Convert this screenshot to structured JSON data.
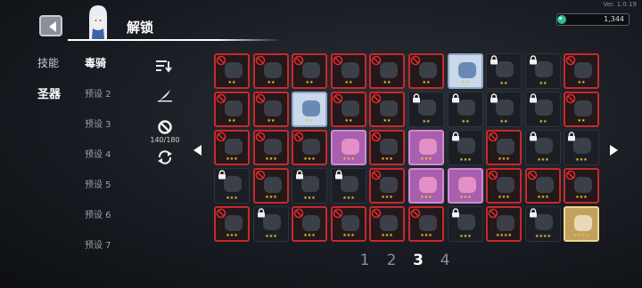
{
  "version": "Ver. 1.0.19",
  "header": {
    "title": "解锁",
    "back_icon": "back-arrow-icon"
  },
  "currency": {
    "amount": "1,344",
    "icon": "gem-icon"
  },
  "side_tabs": [
    {
      "label": "技能",
      "active": false
    },
    {
      "label": "圣器",
      "active": true
    }
  ],
  "presets": [
    {
      "label": "毒骑",
      "active": true
    },
    {
      "label": "预设 2",
      "active": false
    },
    {
      "label": "预设 3",
      "active": false
    },
    {
      "label": "预设 4",
      "active": false
    },
    {
      "label": "预设 5",
      "active": false
    },
    {
      "label": "预设 6",
      "active": false
    },
    {
      "label": "预设 7",
      "active": false
    }
  ],
  "tools": {
    "sort_icon": "sort-icon",
    "quill_icon": "quill-icon",
    "ban_icon": "ban-icon",
    "refresh_icon": "refresh-icon",
    "ban_count": "140/180"
  },
  "pagination": {
    "pages": [
      "1",
      "2",
      "3",
      "4"
    ],
    "current": "3"
  },
  "relics": [
    [
      {
        "ban": true,
        "lock": false,
        "stars": 2,
        "style": "red"
      },
      {
        "ban": true,
        "lock": false,
        "stars": 2,
        "style": "red"
      },
      {
        "ban": true,
        "lock": false,
        "stars": 2,
        "style": "red"
      },
      {
        "ban": true,
        "lock": false,
        "stars": 2,
        "style": "red"
      },
      {
        "ban": true,
        "lock": false,
        "stars": 2,
        "style": "red"
      },
      {
        "ban": true,
        "lock": false,
        "stars": 2,
        "style": "red"
      },
      {
        "ban": false,
        "lock": false,
        "stars": 2,
        "style": "blue"
      },
      {
        "ban": false,
        "lock": true,
        "stars": 2,
        "style": "dark"
      },
      {
        "ban": false,
        "lock": true,
        "stars": 2,
        "style": "dark"
      },
      {
        "ban": true,
        "lock": false,
        "stars": 2,
        "style": "red"
      }
    ],
    [
      {
        "ban": true,
        "lock": false,
        "stars": 2,
        "style": "red"
      },
      {
        "ban": true,
        "lock": false,
        "stars": 2,
        "style": "red"
      },
      {
        "ban": false,
        "lock": false,
        "stars": 2,
        "style": "blue"
      },
      {
        "ban": true,
        "lock": false,
        "stars": 2,
        "style": "red"
      },
      {
        "ban": true,
        "lock": false,
        "stars": 2,
        "style": "red"
      },
      {
        "ban": false,
        "lock": true,
        "stars": 2,
        "style": "dark"
      },
      {
        "ban": false,
        "lock": true,
        "stars": 2,
        "style": "dark"
      },
      {
        "ban": false,
        "lock": true,
        "stars": 2,
        "style": "dark"
      },
      {
        "ban": false,
        "lock": true,
        "stars": 2,
        "style": "dark"
      },
      {
        "ban": true,
        "lock": false,
        "stars": 2,
        "style": "red"
      }
    ],
    [
      {
        "ban": true,
        "lock": false,
        "stars": 3,
        "style": "red"
      },
      {
        "ban": true,
        "lock": false,
        "stars": 3,
        "style": "red"
      },
      {
        "ban": true,
        "lock": false,
        "stars": 3,
        "style": "red"
      },
      {
        "ban": false,
        "lock": false,
        "stars": 3,
        "style": "purple"
      },
      {
        "ban": true,
        "lock": false,
        "stars": 3,
        "style": "red"
      },
      {
        "ban": false,
        "lock": false,
        "stars": 3,
        "style": "purple"
      },
      {
        "ban": false,
        "lock": true,
        "stars": 3,
        "style": "dark"
      },
      {
        "ban": true,
        "lock": false,
        "stars": 3,
        "style": "red"
      },
      {
        "ban": false,
        "lock": true,
        "stars": 3,
        "style": "dark"
      },
      {
        "ban": false,
        "lock": true,
        "stars": 3,
        "style": "dark"
      }
    ],
    [
      {
        "ban": false,
        "lock": true,
        "stars": 3,
        "style": "dark"
      },
      {
        "ban": true,
        "lock": false,
        "stars": 3,
        "style": "red"
      },
      {
        "ban": false,
        "lock": true,
        "stars": 3,
        "style": "dark"
      },
      {
        "ban": false,
        "lock": true,
        "stars": 3,
        "style": "dark"
      },
      {
        "ban": true,
        "lock": false,
        "stars": 3,
        "style": "red"
      },
      {
        "ban": false,
        "lock": false,
        "stars": 3,
        "style": "purple"
      },
      {
        "ban": false,
        "lock": false,
        "stars": 3,
        "style": "purple"
      },
      {
        "ban": true,
        "lock": false,
        "stars": 3,
        "style": "red"
      },
      {
        "ban": true,
        "lock": false,
        "stars": 3,
        "style": "red"
      },
      {
        "ban": true,
        "lock": false,
        "stars": 3,
        "style": "red"
      }
    ],
    [
      {
        "ban": true,
        "lock": false,
        "stars": 3,
        "style": "red"
      },
      {
        "ban": false,
        "lock": true,
        "stars": 3,
        "style": "dark"
      },
      {
        "ban": true,
        "lock": false,
        "stars": 3,
        "style": "red"
      },
      {
        "ban": true,
        "lock": false,
        "stars": 3,
        "style": "red"
      },
      {
        "ban": true,
        "lock": false,
        "stars": 3,
        "style": "red"
      },
      {
        "ban": true,
        "lock": false,
        "stars": 3,
        "style": "red"
      },
      {
        "ban": false,
        "lock": true,
        "stars": 3,
        "style": "dark"
      },
      {
        "ban": true,
        "lock": false,
        "stars": 4,
        "style": "red"
      },
      {
        "ban": false,
        "lock": true,
        "stars": 4,
        "style": "dark"
      },
      {
        "ban": false,
        "lock": false,
        "stars": 4,
        "style": "gold"
      }
    ]
  ]
}
